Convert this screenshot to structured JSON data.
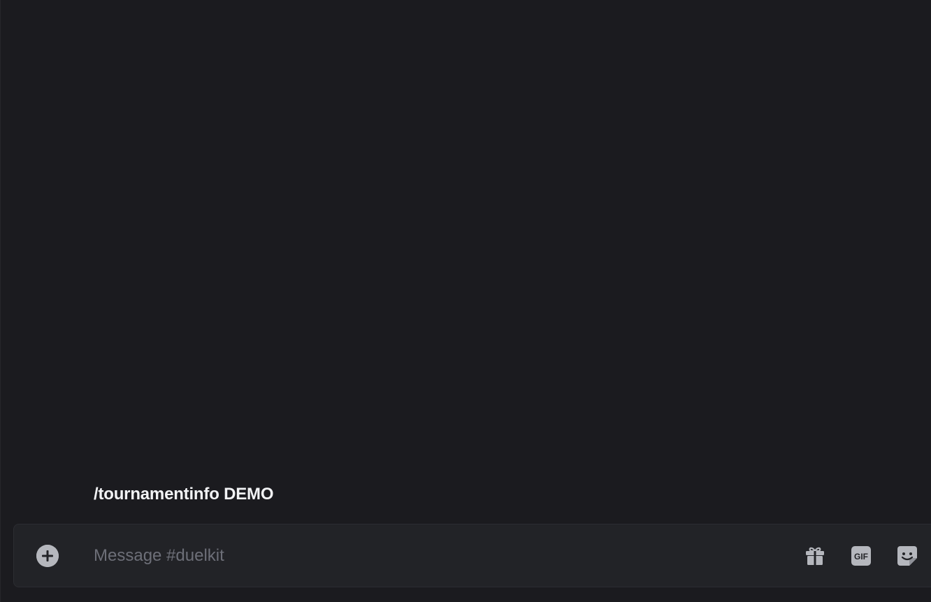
{
  "chat": {
    "draft_message": "/tournamentinfo DEMO"
  },
  "composer": {
    "placeholder": "Message #duelkit",
    "add_icon": "plus-circle-icon",
    "gift_icon": "gift-icon",
    "gif_icon": "gif-icon",
    "gif_label": "GIF",
    "sticker_icon": "sticker-icon"
  },
  "colors": {
    "background": "#1b1b1f",
    "composer_background": "#222327",
    "icon": "#b5b7bd",
    "placeholder": "#6d6f78",
    "text": "#f2f3f5"
  }
}
